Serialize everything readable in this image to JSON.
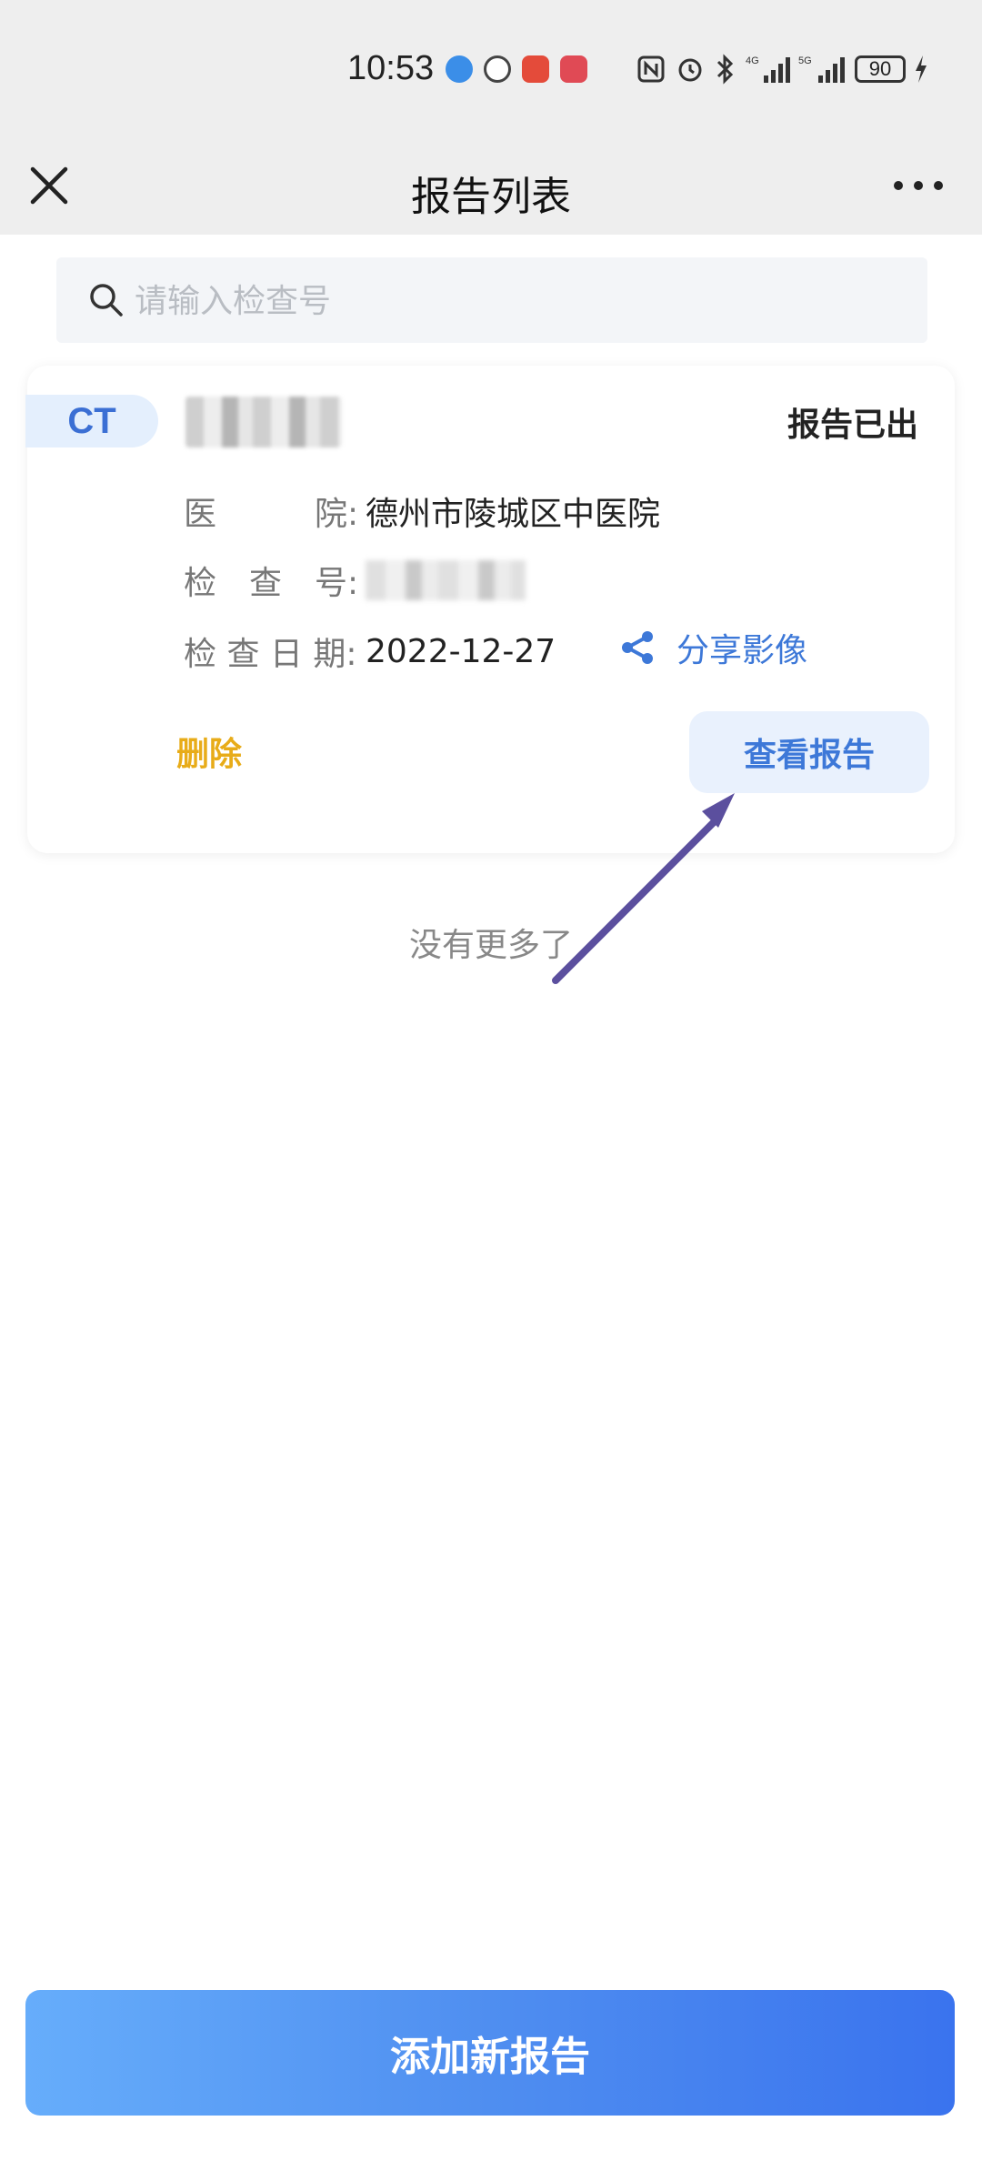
{
  "status_bar": {
    "time": "10:53",
    "battery": "90"
  },
  "navbar": {
    "title": "报告列表",
    "close_icon": "close-icon",
    "more_icon": "more-icon"
  },
  "search": {
    "placeholder": "请输入检查号",
    "value": ""
  },
  "report": {
    "type": "CT",
    "status": "报告已出",
    "hospital_label": "医　　　院:",
    "hospital": "德州市陵城区中医院",
    "exam_no_label": "检　查　号:",
    "exam_date_label": "检 查 日 期:",
    "exam_date": "2022-12-27",
    "share_label": "分享影像",
    "delete_label": "删除",
    "view_label": "查看报告"
  },
  "list": {
    "end_text": "没有更多了"
  },
  "footer": {
    "add_label": "添加新报告"
  },
  "colors": {
    "accent": "#3d78d8",
    "warning": "#e8ac19",
    "annotation_arrow": "#5b4f9e"
  }
}
